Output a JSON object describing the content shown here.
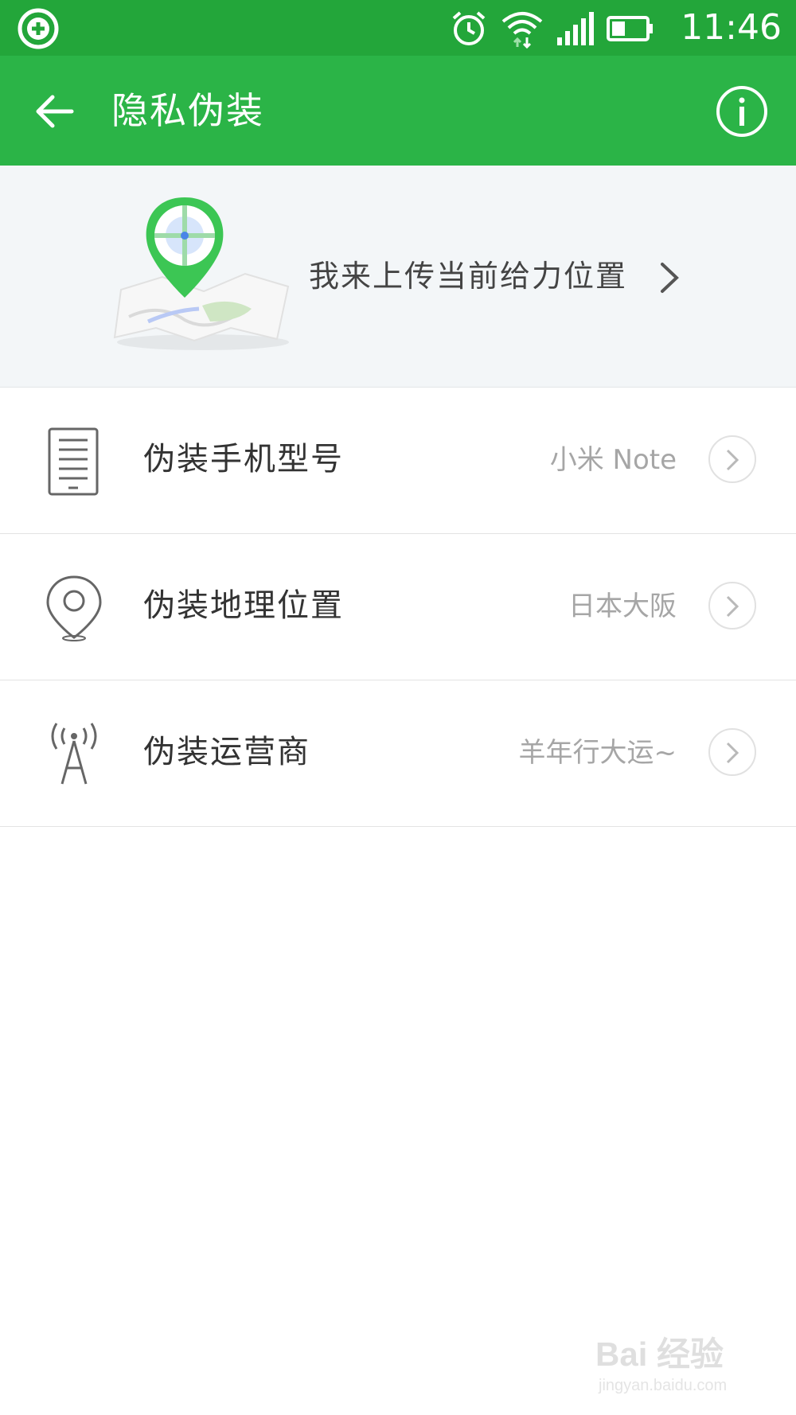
{
  "status_bar": {
    "time": "11:46",
    "icons": [
      "app-badge-icon",
      "alarm-icon",
      "wifi-icon",
      "signal-icon",
      "battery-icon"
    ]
  },
  "app_bar": {
    "title": "隐私伪装",
    "back_icon": "arrow-left-icon",
    "info_icon": "info-icon"
  },
  "banner": {
    "text": "我来上传当前给力位置",
    "icon": "map-pin-illustration"
  },
  "settings": [
    {
      "label": "伪装手机型号",
      "value": "小米 Note",
      "icon": "phone-icon"
    },
    {
      "label": "伪装地理位置",
      "value": "日本大阪",
      "icon": "location-pin-icon"
    },
    {
      "label": "伪装运营商",
      "value": "羊年行大运~",
      "icon": "antenna-icon"
    }
  ],
  "watermark": {
    "brand": "Bai 经验",
    "url": "jingyan.baidu.com"
  },
  "colors": {
    "status_bar": "#23a63a",
    "app_bar": "#2bb447",
    "banner_bg": "#f3f6f8",
    "accent_green": "#3cc654"
  }
}
